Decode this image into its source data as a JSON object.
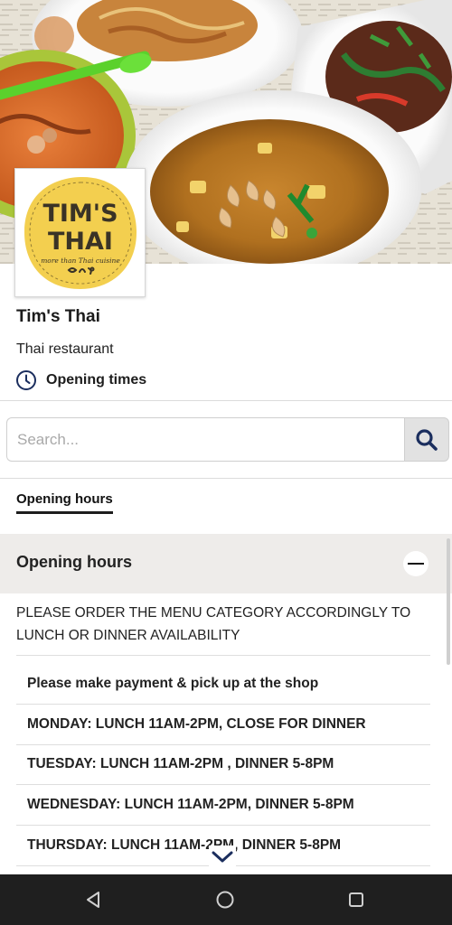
{
  "hero": {
    "image": "thai-food-dishes-photo"
  },
  "logo": {
    "line1": "TIM'S",
    "line2": "THAI",
    "tagline": "more than Thai cuisine",
    "colors": {
      "badge": "#f3cf4f",
      "ink": "#3a3326"
    }
  },
  "business": {
    "name": "Tim's Thai",
    "type": "Thai restaurant",
    "hours_link": "Opening times",
    "hours_icon": "clock-icon"
  },
  "search": {
    "placeholder": "Search...",
    "value": "",
    "button_icon": "search-icon",
    "accent": "#1b2e5e"
  },
  "tabs": [
    {
      "label": "Opening hours",
      "active": true
    }
  ],
  "opening_hours": {
    "title": "Opening hours",
    "expanded": true,
    "toggle_icon": "minus-icon",
    "note": "PLEASE ORDER THE MENU CATEGORY ACCORDINGLY TO LUNCH OR DINNER AVAILABILITY",
    "entries": [
      "Please make payment & pick up at the shop",
      "MONDAY: LUNCH 11AM-2PM, CLOSE FOR DINNER",
      "TUESDAY: LUNCH 11AM-2PM , DINNER 5-8PM",
      "WEDNESDAY: LUNCH 11AM-2PM, DINNER 5-8PM",
      "THURSDAY: LUNCH 11AM-2PM, DINNER 5-8PM"
    ]
  },
  "scroll_hint_icon": "chevron-down-icon",
  "navbar": {
    "back_icon": "back-triangle-icon",
    "home_icon": "home-circle-icon",
    "recent_icon": "recent-apps-icon",
    "color": "#1f1f1f"
  }
}
